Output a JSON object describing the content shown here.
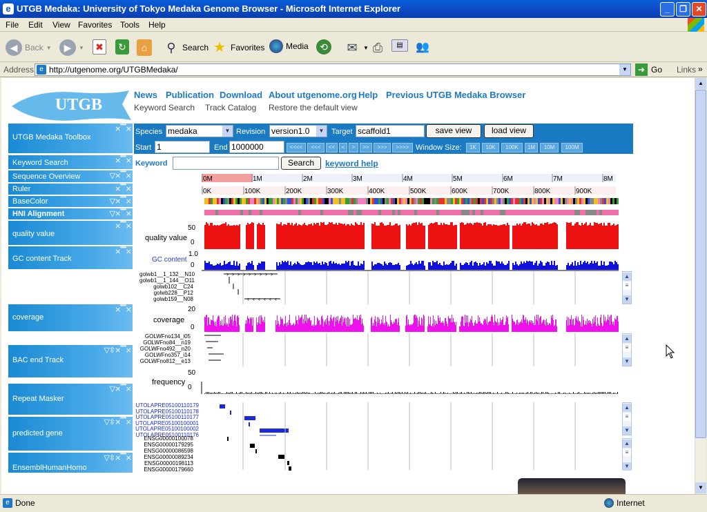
{
  "window": {
    "title": "UTGB Medaka: University of Tokyo Medaka Genome Browser - Microsoft Internet Explorer"
  },
  "menu": [
    "File",
    "Edit",
    "View",
    "Favorites",
    "Tools",
    "Help"
  ],
  "toolbar": {
    "back": "Back",
    "search": "Search",
    "favorites": "Favorites",
    "media": "Media"
  },
  "address": {
    "label": "Address",
    "url": "http://utgenome.org/UTGBMedaka/",
    "go": "Go",
    "links": "Links"
  },
  "logo": "UTGB",
  "nav": {
    "primary": [
      "News",
      "Publication",
      "Download",
      "About utgenome.org",
      "Help",
      "Previous UTGB Medaka Browser"
    ],
    "secondary": [
      "Keyword Search",
      "Track Catalog",
      "Restore the default view"
    ]
  },
  "sidebar": [
    "UTGB Medaka Toolbox",
    "Keyword Search",
    "Sequence Overview",
    "Ruler",
    "BaseColor",
    "HNI Alignment",
    "quality value",
    "GC content Track",
    "coverage",
    "BAC end Track",
    "Repeat Masker",
    "predicted gene",
    "EnsemblHumanHomo"
  ],
  "controls": {
    "species_label": "Species",
    "species": "medaka",
    "revision_label": "Revision",
    "revision": "version1.0",
    "target_label": "Target",
    "target": "scaffold1",
    "save": "save view",
    "load": "load view",
    "start_label": "Start",
    "start": "1",
    "end_label": "End",
    "end": "1000000",
    "nav_buttons": [
      "<<<<",
      "<<<",
      "<<",
      "<",
      ">",
      ">>",
      ">>>",
      ">>>>"
    ],
    "window_label": "Window Size:",
    "window_sizes": [
      "1K",
      "10K",
      "100K",
      "1M",
      "10M",
      "100M"
    ]
  },
  "keyword": {
    "label": "Keyword",
    "button": "Search",
    "help": "keyword help"
  },
  "ruler_top": [
    "0M",
    "1M",
    "2M",
    "3M",
    "4M",
    "5M",
    "6M",
    "7M",
    "8M"
  ],
  "ruler_bottom": [
    "0K",
    "100K",
    "200K",
    "300K",
    "400K",
    "500K",
    "600K",
    "700K",
    "800K",
    "900K"
  ],
  "tracks": {
    "quality": {
      "label": "quality value",
      "max": "50",
      "min": "0"
    },
    "gc": {
      "label": "GC content",
      "max": "1.0",
      "min": "0"
    },
    "coverage": {
      "label": "coverage",
      "max": "20",
      "min": "0"
    },
    "frequency": {
      "label": "frequency",
      "max": "50",
      "min": "0"
    }
  },
  "hni_reads": [
    "golwb1__1_132__N10",
    "golwb1__1_144__O11",
    "golwb102__C24",
    "golwb228__P12",
    "golwb159__N08"
  ],
  "bac_reads": [
    "GOLWFno134_i05",
    "GOLWFno84__n19",
    "GOLWFno492__n20",
    "GOLWFno357_i14",
    "GOLWFno812__e13"
  ],
  "predicted": [
    "UTOLAPRE05100110179",
    "UTOLAPRE05100110178",
    "UTOLAPRE05100110177",
    "UTOLAPRE05100100001",
    "UTOLAPRE05100100002",
    "UTOLAPRE05100110176"
  ],
  "ensembl": [
    "ENSG00000100078",
    "ENSG00000179295",
    "ENSG00000086598",
    "ENSG00000089234",
    "ENSG00000198113",
    "ENSG00000179660"
  ],
  "status": {
    "done": "Done",
    "zone": "Internet"
  },
  "colors": {
    "quality": "#ee1111",
    "gc": "#1111dd",
    "coverage": "#ee11ee"
  }
}
